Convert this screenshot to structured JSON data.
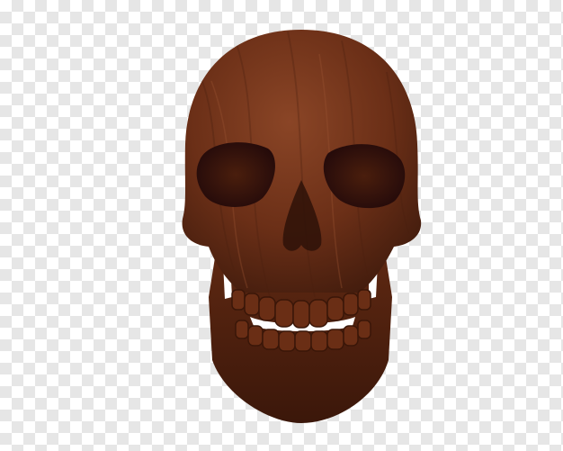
{
  "image": {
    "subject": "wooden-skull",
    "background": "transparency-checkerboard",
    "colors": {
      "wood_dark": "#3e1a0c",
      "wood_mid": "#6b2f17",
      "wood_light": "#8a4526",
      "socket": "#2a0f06",
      "checker_light": "#ffffff",
      "checker_dark": "#e6e6e6"
    }
  }
}
